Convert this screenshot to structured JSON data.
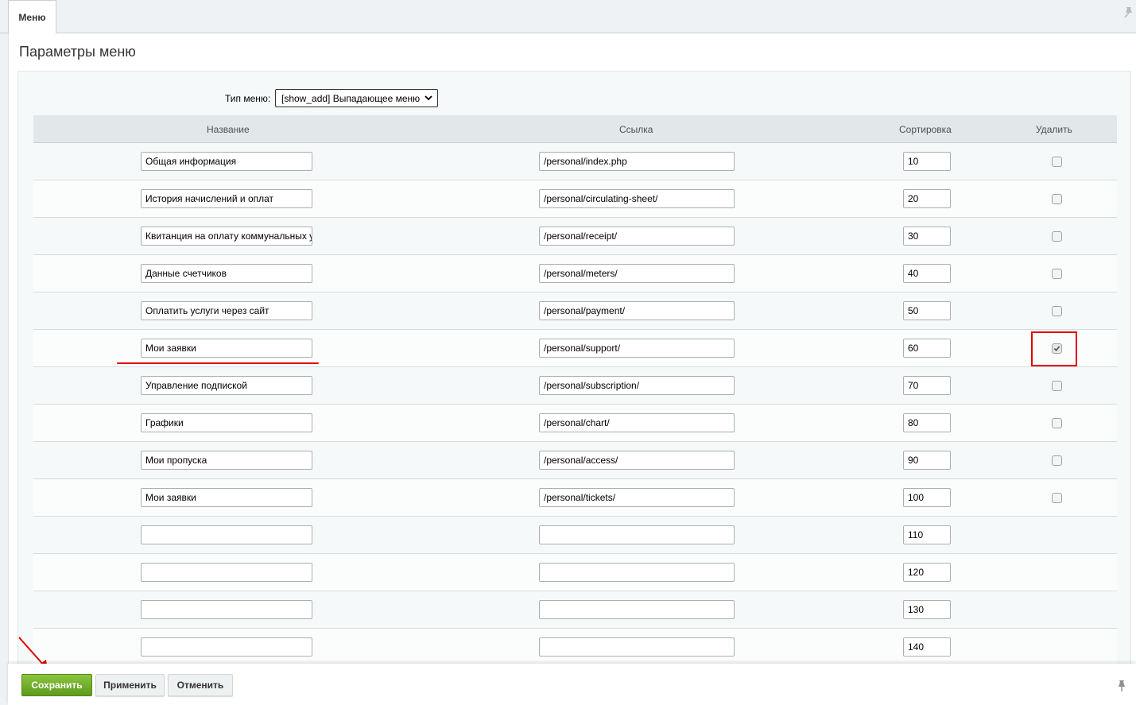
{
  "tab": {
    "label": "Меню"
  },
  "page": {
    "title": "Параметры меню"
  },
  "menu_type": {
    "label": "Тип меню:",
    "value": "[show_add] Выпадающее меню"
  },
  "columns": {
    "name": "Название",
    "link": "Ссылка",
    "sort": "Сортировка",
    "delete": "Удалить"
  },
  "rows": [
    {
      "name": "Общая информация",
      "link": "/personal/index.php",
      "sort": "10",
      "deletable": true,
      "delete_checked": false
    },
    {
      "name": "История начислений и оплат",
      "link": "/personal/circulating-sheet/",
      "sort": "20",
      "deletable": true,
      "delete_checked": false
    },
    {
      "name": "Квитанция на оплату коммунальных у",
      "link": "/personal/receipt/",
      "sort": "30",
      "deletable": true,
      "delete_checked": false
    },
    {
      "name": "Данные счетчиков",
      "link": "/personal/meters/",
      "sort": "40",
      "deletable": true,
      "delete_checked": false
    },
    {
      "name": "Оплатить услуги через сайт",
      "link": "/personal/payment/",
      "sort": "50",
      "deletable": true,
      "delete_checked": false
    },
    {
      "name": "Мои заявки",
      "link": "/personal/support/",
      "sort": "60",
      "deletable": true,
      "delete_checked": true
    },
    {
      "name": "Управление подпиской",
      "link": "/personal/subscription/",
      "sort": "70",
      "deletable": true,
      "delete_checked": false
    },
    {
      "name": "Графики",
      "link": "/personal/chart/",
      "sort": "80",
      "deletable": true,
      "delete_checked": false
    },
    {
      "name": "Мои пропуска",
      "link": "/personal/access/",
      "sort": "90",
      "deletable": true,
      "delete_checked": false
    },
    {
      "name": "Мои заявки",
      "link": "/personal/tickets/",
      "sort": "100",
      "deletable": true,
      "delete_checked": false
    },
    {
      "name": "",
      "link": "",
      "sort": "110",
      "deletable": false,
      "delete_checked": false
    },
    {
      "name": "",
      "link": "",
      "sort": "120",
      "deletable": false,
      "delete_checked": false
    },
    {
      "name": "",
      "link": "",
      "sort": "130",
      "deletable": false,
      "delete_checked": false
    },
    {
      "name": "",
      "link": "",
      "sort": "140",
      "deletable": false,
      "delete_checked": false
    }
  ],
  "footer": {
    "save_label": "Сохранить",
    "apply_label": "Применить",
    "cancel_label": "Отменить"
  },
  "icons": {
    "pin": "pin-icon",
    "dropdown": "chevron-down-icon",
    "check": "check-icon"
  },
  "colors": {
    "save_button": "#6aab26",
    "annotation": "#e00000",
    "header_bg": "#e0e8ea"
  }
}
